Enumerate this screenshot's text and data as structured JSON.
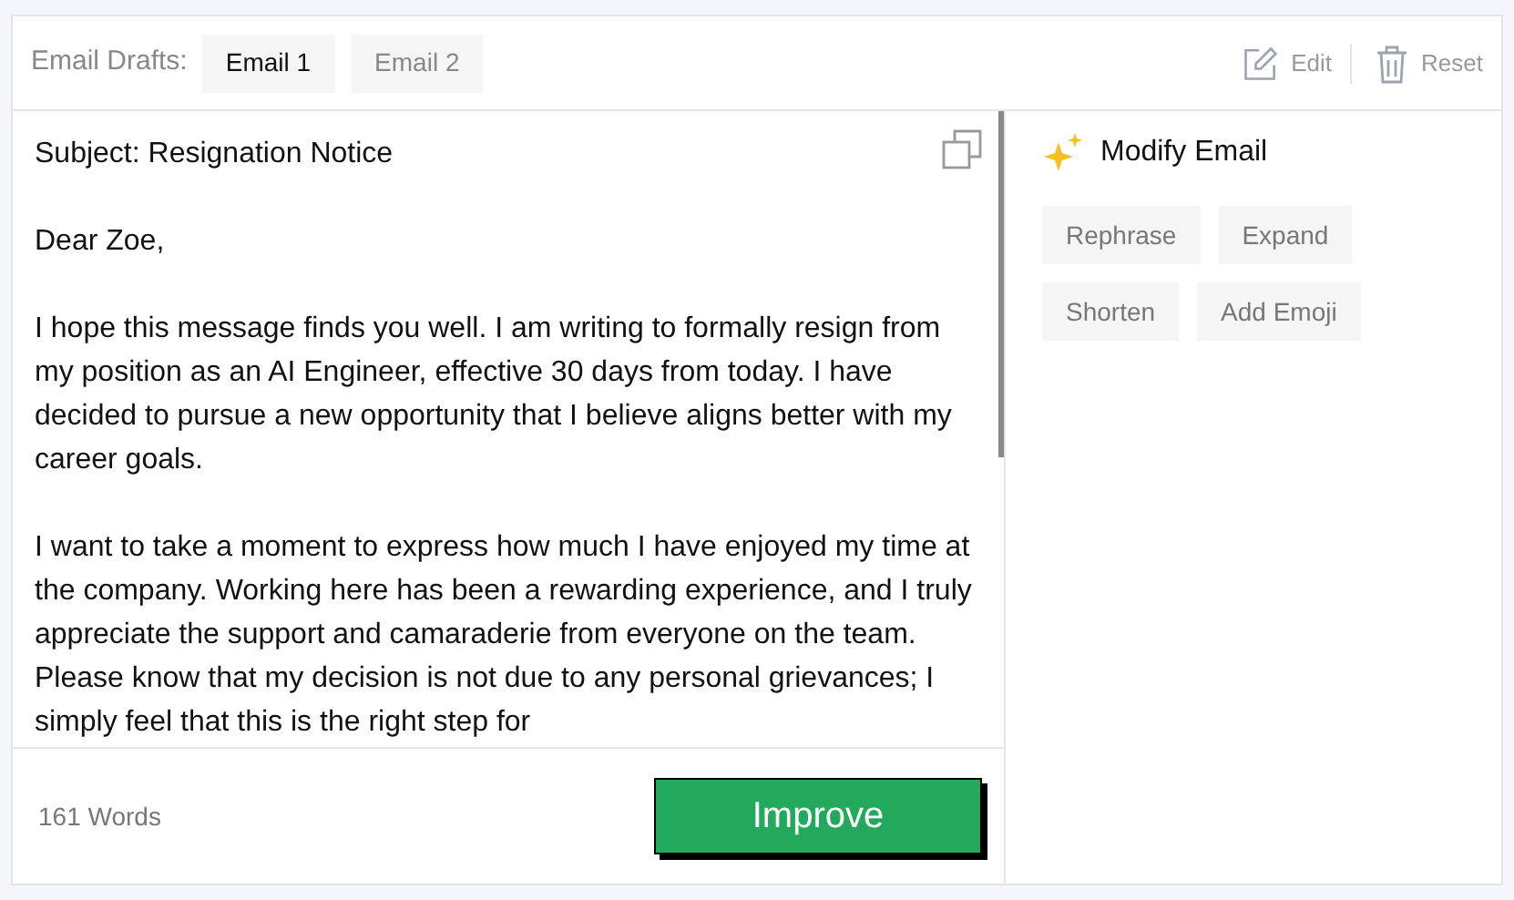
{
  "header": {
    "label": "Email Drafts:",
    "tabs": [
      {
        "label": "Email 1",
        "selected": true
      },
      {
        "label": "Email 2",
        "selected": false
      }
    ],
    "actions": [
      {
        "kind": "edit",
        "label": "Edit"
      },
      {
        "kind": "reset",
        "label": "Reset"
      }
    ]
  },
  "email": {
    "subject": "Subject: Resignation Notice",
    "paragraphs": [
      "Dear Zoe,",
      "I hope this message finds you well. I am writing to formally resign from my position as an AI Engineer, effective 30 days from today. I have decided to pursue a new opportunity that I believe aligns better with my career goals.",
      "I want to take a moment to express how much I have enjoyed my time at the company. Working here has been a rewarding experience, and I truly appreciate the support and camaraderie from everyone on the team. Please know that my decision is not due to any personal grievances; I simply feel that this is the right step for"
    ],
    "word_count": "161 Words",
    "improve_button": "Improve"
  },
  "modify": {
    "title": "Modify Email",
    "options": [
      [
        "Rephrase",
        "Expand"
      ],
      [
        "Shorten",
        "Add Emoji"
      ]
    ]
  }
}
